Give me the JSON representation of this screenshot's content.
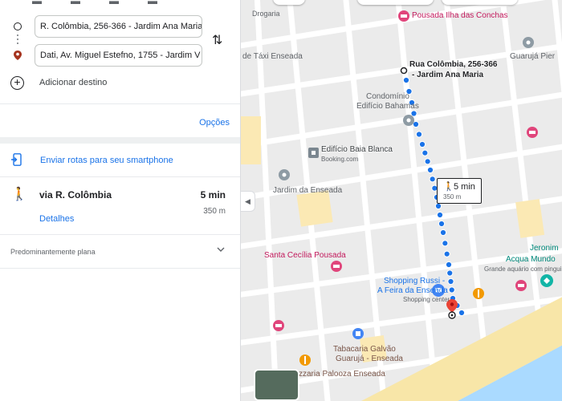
{
  "panel": {
    "origin_value": "R. Colômbia, 256-366 - Jardim Ana Maria",
    "destination_value": "Dati, Av. Miguel Estefno, 1755 - Jardim V",
    "add_destination": "Adicionar destino",
    "options": "Opções",
    "send_to_phone": "Enviar rotas para seu smartphone",
    "route": {
      "via": "via R. Colômbia",
      "time": "5 min",
      "distance": "350 m",
      "details": "Detalhes"
    },
    "terrain": "Predominantemente plana"
  },
  "map": {
    "labels": {
      "drogaria": "Drogaria",
      "pousada_ilha": "Pousada Ilha das Conchas",
      "taxi": "de Táxi Enseada",
      "guaruja_pier": "Guarujá Pier",
      "origin_line1": "Rua Colômbia, 256-366",
      "origin_line2": "- Jardim Ana Maria",
      "condominio1": "Condomínio",
      "condominio2": "Edifício Bahamas",
      "baia_blanca": "Edifício Baia Blanca",
      "booking": "Booking.com",
      "jardim_enseada": "Jardim da Enseada",
      "santa_cecilia": "Santa Cecília Pousada",
      "jeronimo": "Jeronim",
      "acqua_mundo": "Acqua Mundo",
      "aquario_desc": "Grande aquário com pinguins e tubarões",
      "shopping_russi1": "Shopping Russi -",
      "shopping_russi2": "A Feira da Enseada",
      "shopping_center": "Shopping center",
      "tabacaria1": "Tabacaria Galvão",
      "tabacaria2": "Guarujá - Enseada",
      "pizzaria": "zzaria Palooza Enseada"
    },
    "walk_box": {
      "time": "5 min",
      "distance": "350 m"
    }
  },
  "colors": {
    "route": "#1a73e8",
    "pin": "#ea4335",
    "beach": "#f8e6a8",
    "sea": "#aadaff",
    "road": "#ffffff",
    "block": "#ebebeb"
  }
}
